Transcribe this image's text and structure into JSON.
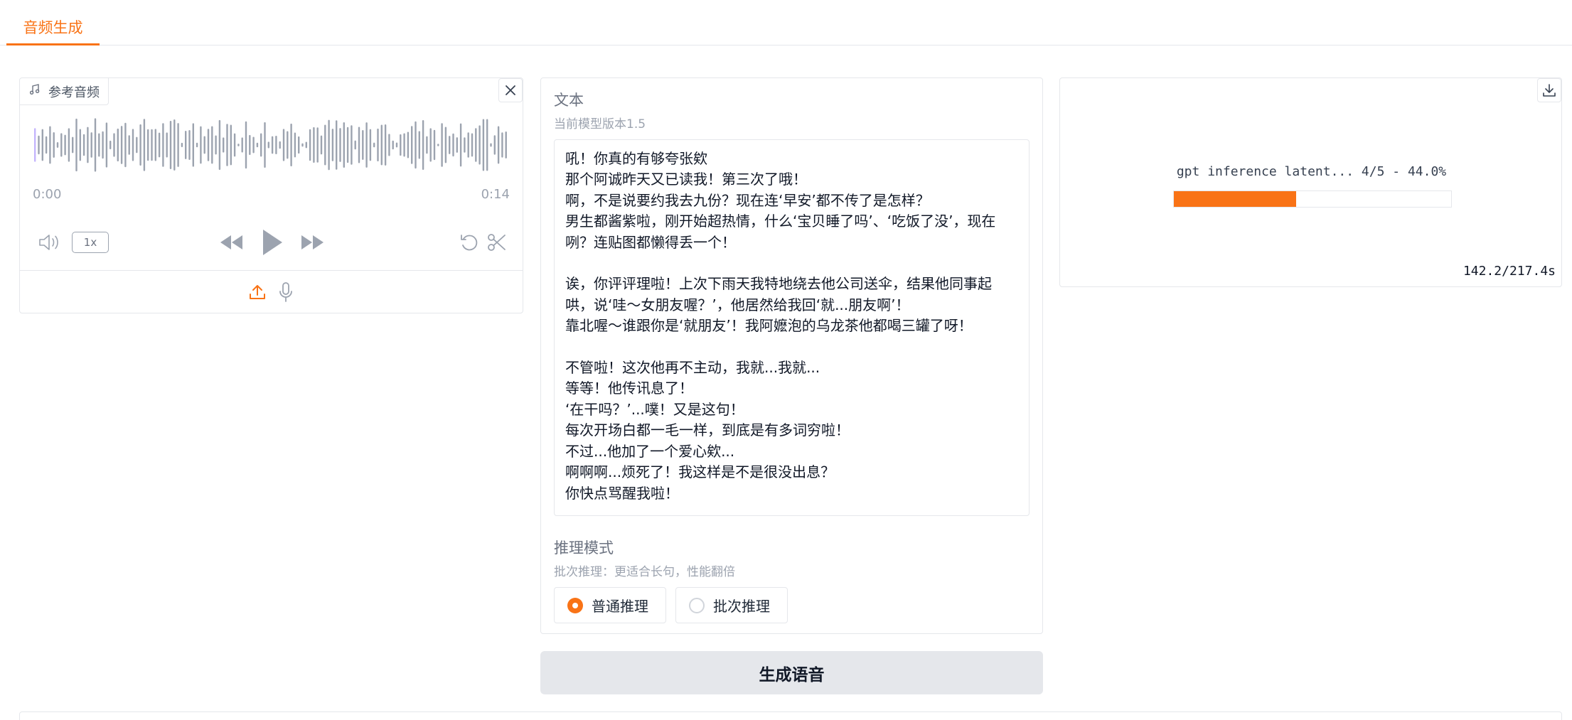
{
  "tabs": [
    {
      "label": "音频生成"
    }
  ],
  "audio": {
    "label": "参考音频",
    "time_start": "0:00",
    "time_end": "0:14",
    "speed": "1x"
  },
  "text_block": {
    "label": "文本",
    "info": "当前模型版本1.5",
    "value": "吼！你真的有够夸张欸\n那个阿诚昨天又已读我！第三次了哦！\n啊，不是说要约我去九份？现在连‘早安’都不传了是怎样？\n男生都酱紫啦，刚开始超热情，什么‘宝贝睡了吗’、‘吃饭了没’，现在咧？连贴图都懒得丢一个！\n\n诶，你评评理啦！上次下雨天我特地绕去他公司送伞，结果他同事起哄，说‘哇～女朋友喔？’，他居然给我回‘就...朋友啊’！\n靠北喔～谁跟你是‘就朋友’！我阿嬷泡的乌龙茶他都喝三罐了呀！\n\n不管啦！这次他再不主动，我就...我就...\n等等！他传讯息了！\n‘在干吗？’...噗！又是这句！\n每次开场白都一毛一样，到底是有多词穷啦！\n不过...他加了一个爱心欸...\n啊啊啊...烦死了！我这样是不是很没出息？\n你快点骂醒我啦！"
  },
  "mode": {
    "label": "推理模式",
    "info": "批次推理：更适合长句，性能翻倍",
    "options": [
      "普通推理",
      "批次推理"
    ],
    "selected": "普通推理"
  },
  "generate_label": "生成语音",
  "output": {
    "progress_text": "gpt inference latent... 4/5 - 44.0%",
    "progress_fraction": 0.44,
    "elapsed": "142.2/217.4s"
  },
  "colors": {
    "accent": "#f97316",
    "muted": "#9ca3af"
  }
}
